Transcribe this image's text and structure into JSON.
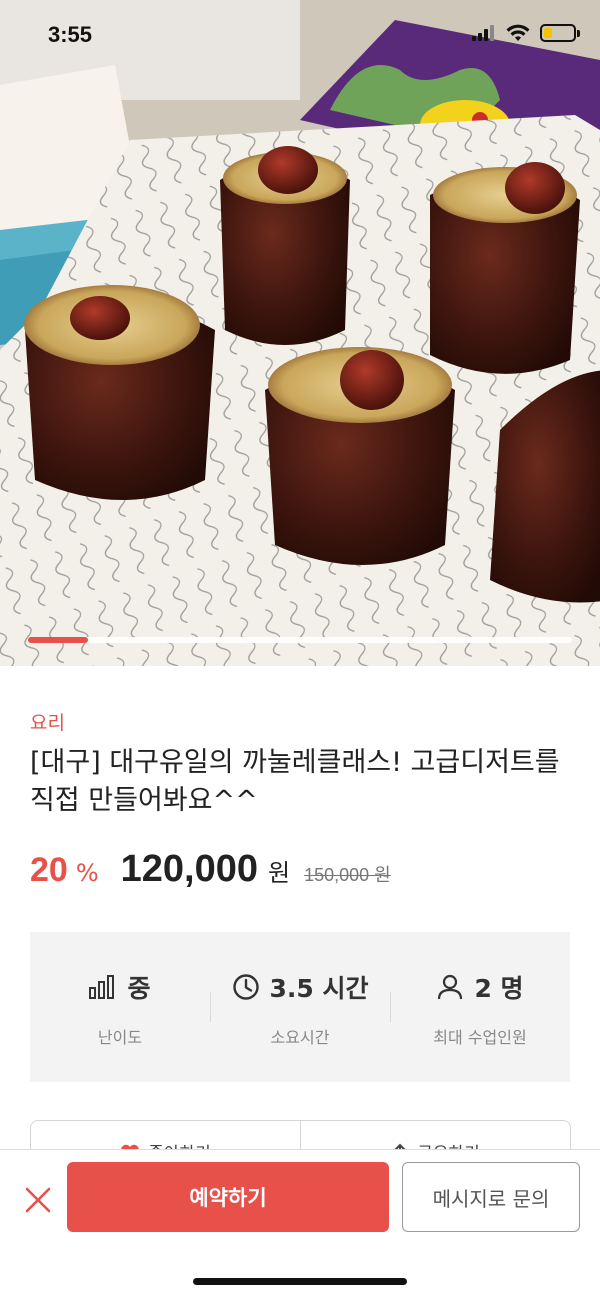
{
  "status_bar": {
    "time": "3:55",
    "battery_level": 0.3,
    "battery_color": "#f5c400"
  },
  "hero": {
    "image_alt": "까눌레 사진",
    "slide_progress": 0.11
  },
  "product": {
    "category": "요리",
    "title": "[대구] 대구유일의 까눌레클래스! 고급디저트를 직접 만들어봐요^^",
    "discount_value": "20",
    "discount_unit": "%",
    "price": "120,000",
    "price_unit": "원",
    "original_price": "150,000 원"
  },
  "info": [
    {
      "icon": "bar-chart-icon",
      "value": "중",
      "label": "난이도"
    },
    {
      "icon": "clock-icon",
      "value": "3.5 시간",
      "label": "소요시간"
    },
    {
      "icon": "person-icon",
      "value": "2 명",
      "label": "최대 수업인원"
    }
  ],
  "actions": [
    {
      "icon": "heart-icon",
      "label": "좋아하기"
    },
    {
      "icon": "share-icon",
      "label": "공유하기"
    }
  ],
  "bottom_bar": {
    "close_icon": "close-icon",
    "reserve_label": "예약하기",
    "message_label": "메시지로 문의"
  },
  "colors": {
    "accent": "#e8504a",
    "text_dark": "#222222",
    "text_muted": "#888888",
    "info_bg": "#f3f3f3"
  }
}
